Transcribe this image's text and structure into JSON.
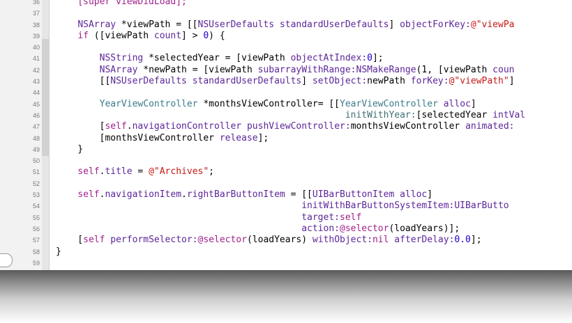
{
  "editor": {
    "lines": [
      {
        "num": "36",
        "tokens": [
          {
            "t": "    ",
            "c": "plain"
          },
          {
            "t": "[super viewDidLoad];",
            "c": "kw"
          }
        ]
      },
      {
        "num": "37",
        "tokens": []
      },
      {
        "num": "38",
        "tokens": [
          {
            "t": "    ",
            "c": "plain"
          },
          {
            "t": "NSArray",
            "c": "type"
          },
          {
            "t": " *viewPath = [[",
            "c": "plain"
          },
          {
            "t": "NSUserDefaults",
            "c": "type"
          },
          {
            "t": " ",
            "c": "plain"
          },
          {
            "t": "standardUserDefaults",
            "c": "type"
          },
          {
            "t": "] ",
            "c": "plain"
          },
          {
            "t": "objectForKey:",
            "c": "type"
          },
          {
            "t": "@\"viewPa",
            "c": "str"
          }
        ]
      },
      {
        "num": "39",
        "tokens": [
          {
            "t": "    ",
            "c": "plain"
          },
          {
            "t": "if",
            "c": "kw"
          },
          {
            "t": " ([viewPath ",
            "c": "plain"
          },
          {
            "t": "count",
            "c": "type"
          },
          {
            "t": "] > ",
            "c": "plain"
          },
          {
            "t": "0",
            "c": "num"
          },
          {
            "t": ") {",
            "c": "plain"
          }
        ]
      },
      {
        "num": "40",
        "tokens": []
      },
      {
        "num": "41",
        "tokens": [
          {
            "t": "        ",
            "c": "plain"
          },
          {
            "t": "NSString",
            "c": "type"
          },
          {
            "t": " *selectedYear = [viewPath ",
            "c": "plain"
          },
          {
            "t": "objectAtIndex:",
            "c": "type"
          },
          {
            "t": "0",
            "c": "num"
          },
          {
            "t": "];",
            "c": "plain"
          }
        ]
      },
      {
        "num": "42",
        "tokens": [
          {
            "t": "        ",
            "c": "plain"
          },
          {
            "t": "NSArray",
            "c": "type"
          },
          {
            "t": " *newPath = [viewPath ",
            "c": "plain"
          },
          {
            "t": "subarrayWithRange:NSMakeRange",
            "c": "type"
          },
          {
            "t": "(1, [viewPath ",
            "c": "plain"
          },
          {
            "t": "coun",
            "c": "type"
          }
        ]
      },
      {
        "num": "43",
        "tokens": [
          {
            "t": "        [[",
            "c": "plain"
          },
          {
            "t": "NSUserDefaults",
            "c": "type"
          },
          {
            "t": " ",
            "c": "plain"
          },
          {
            "t": "standardUserDefaults",
            "c": "type"
          },
          {
            "t": "] ",
            "c": "plain"
          },
          {
            "t": "setObject:",
            "c": "type"
          },
          {
            "t": "newPath ",
            "c": "plain"
          },
          {
            "t": "forKey:",
            "c": "type"
          },
          {
            "t": "@\"viewPath\"",
            "c": "str"
          },
          {
            "t": "]",
            "c": "plain"
          }
        ]
      },
      {
        "num": "44",
        "tokens": []
      },
      {
        "num": "45",
        "tokens": [
          {
            "t": "        ",
            "c": "plain"
          },
          {
            "t": "YearViewController",
            "c": "cls"
          },
          {
            "t": " *monthsViewController= [[",
            "c": "plain"
          },
          {
            "t": "YearViewController",
            "c": "cls"
          },
          {
            "t": " ",
            "c": "plain"
          },
          {
            "t": "alloc",
            "c": "type"
          },
          {
            "t": "]",
            "c": "plain"
          }
        ]
      },
      {
        "num": "46",
        "tokens": [
          {
            "t": "                                                     ",
            "c": "plain"
          },
          {
            "t": "initWithYear:",
            "c": "prop"
          },
          {
            "t": "[selectedYear ",
            "c": "plain"
          },
          {
            "t": "intVal",
            "c": "type"
          }
        ]
      },
      {
        "num": "47",
        "tokens": [
          {
            "t": "        [",
            "c": "plain"
          },
          {
            "t": "self",
            "c": "kw"
          },
          {
            "t": ".",
            "c": "plain"
          },
          {
            "t": "navigationController",
            "c": "type"
          },
          {
            "t": " ",
            "c": "plain"
          },
          {
            "t": "pushViewController:",
            "c": "type"
          },
          {
            "t": "monthsViewController ",
            "c": "plain"
          },
          {
            "t": "animated:",
            "c": "type"
          }
        ]
      },
      {
        "num": "48",
        "tokens": [
          {
            "t": "        [monthsViewController ",
            "c": "plain"
          },
          {
            "t": "release",
            "c": "type"
          },
          {
            "t": "];",
            "c": "plain"
          }
        ]
      },
      {
        "num": "49",
        "tokens": [
          {
            "t": "    }",
            "c": "plain"
          }
        ]
      },
      {
        "num": "50",
        "tokens": []
      },
      {
        "num": "51",
        "tokens": [
          {
            "t": "    ",
            "c": "plain"
          },
          {
            "t": "self",
            "c": "kw"
          },
          {
            "t": ".",
            "c": "plain"
          },
          {
            "t": "title",
            "c": "type"
          },
          {
            "t": " = ",
            "c": "plain"
          },
          {
            "t": "@\"Archives\"",
            "c": "str"
          },
          {
            "t": ";",
            "c": "plain"
          }
        ]
      },
      {
        "num": "52",
        "tokens": []
      },
      {
        "num": "53",
        "tokens": [
          {
            "t": "    ",
            "c": "plain"
          },
          {
            "t": "self",
            "c": "kw"
          },
          {
            "t": ".",
            "c": "plain"
          },
          {
            "t": "navigationItem",
            "c": "type"
          },
          {
            "t": ".",
            "c": "plain"
          },
          {
            "t": "rightBarButtonItem",
            "c": "type"
          },
          {
            "t": " = [[",
            "c": "plain"
          },
          {
            "t": "UIBarButtonItem",
            "c": "type"
          },
          {
            "t": " ",
            "c": "plain"
          },
          {
            "t": "alloc",
            "c": "type"
          },
          {
            "t": "]",
            "c": "plain"
          }
        ]
      },
      {
        "num": "54",
        "tokens": [
          {
            "t": "                                             ",
            "c": "plain"
          },
          {
            "t": "initWithBarButtonSystemItem:UIBarButto",
            "c": "type"
          }
        ]
      },
      {
        "num": "55",
        "tokens": [
          {
            "t": "                                             ",
            "c": "plain"
          },
          {
            "t": "target:",
            "c": "type"
          },
          {
            "t": "self",
            "c": "kw"
          }
        ]
      },
      {
        "num": "56",
        "tokens": [
          {
            "t": "                                             ",
            "c": "plain"
          },
          {
            "t": "action:",
            "c": "type"
          },
          {
            "t": "@selector",
            "c": "kw"
          },
          {
            "t": "(loadYears)];",
            "c": "plain"
          }
        ]
      },
      {
        "num": "57",
        "tokens": [
          {
            "t": "    [",
            "c": "plain"
          },
          {
            "t": "self",
            "c": "kw"
          },
          {
            "t": " ",
            "c": "plain"
          },
          {
            "t": "performSelector:",
            "c": "type"
          },
          {
            "t": "@selector",
            "c": "kw"
          },
          {
            "t": "(loadYears) ",
            "c": "plain"
          },
          {
            "t": "withObject:",
            "c": "type"
          },
          {
            "t": "nil",
            "c": "kw"
          },
          {
            "t": " ",
            "c": "plain"
          },
          {
            "t": "afterDelay:",
            "c": "type"
          },
          {
            "t": "0.0",
            "c": "num"
          },
          {
            "t": "];",
            "c": "plain"
          }
        ]
      },
      {
        "num": "58",
        "tokens": [
          {
            "t": "}",
            "c": "plain"
          }
        ]
      },
      {
        "num": "59",
        "tokens": []
      }
    ]
  }
}
